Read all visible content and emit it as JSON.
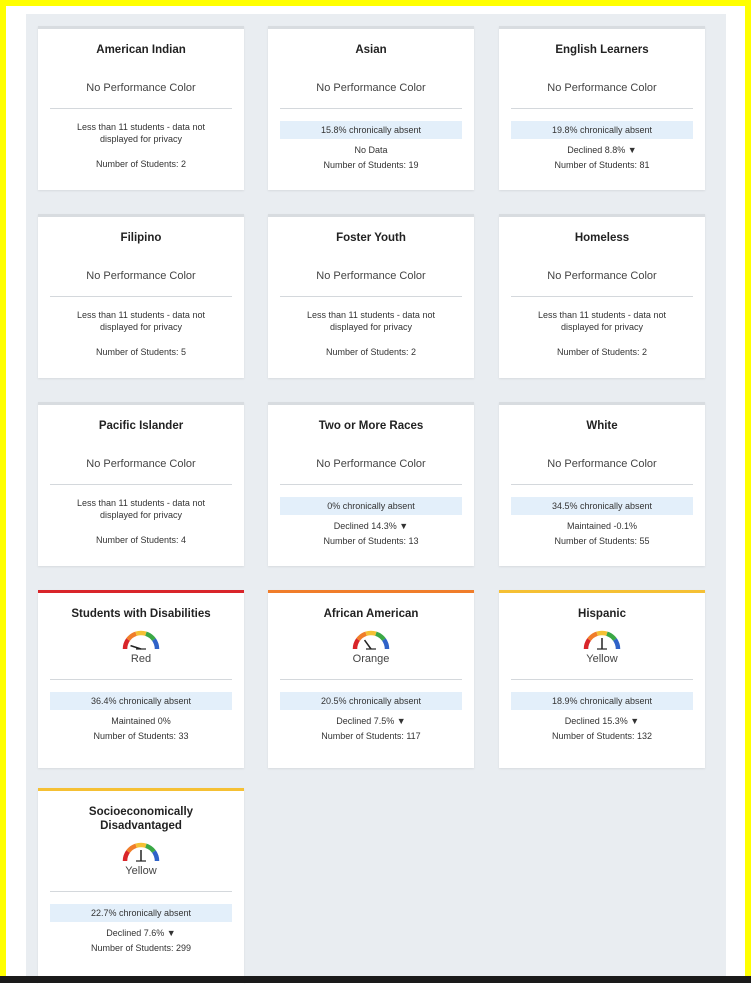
{
  "cards": [
    {
      "title": "American Indian",
      "color_label": "No Performance Color",
      "privacy": "Less than 11 students - data not displayed for privacy",
      "students": "Number of Students: 2"
    },
    {
      "title": "Asian",
      "color_label": "No Performance Color",
      "absent": "15.8% chronically absent",
      "change": "No Data",
      "students": "Number of Students: 19"
    },
    {
      "title": "English Learners",
      "color_label": "No Performance Color",
      "absent": "19.8% chronically absent",
      "change": "Declined 8.8% ▼",
      "students": "Number of Students: 81"
    },
    {
      "title": "Filipino",
      "color_label": "No Performance Color",
      "privacy": "Less than 11 students - data not displayed for privacy",
      "students": "Number of Students: 5"
    },
    {
      "title": "Foster Youth",
      "color_label": "No Performance Color",
      "privacy": "Less than 11 students - data not displayed for privacy",
      "students": "Number of Students: 2"
    },
    {
      "title": "Homeless",
      "color_label": "No Performance Color",
      "privacy": "Less than 11 students - data not displayed for privacy",
      "students": "Number of Students: 2"
    },
    {
      "title": "Pacific Islander",
      "color_label": "No Performance Color",
      "privacy": "Less than 11 students - data not displayed for privacy",
      "students": "Number of Students: 4"
    },
    {
      "title": "Two or More Races",
      "color_label": "No Performance Color",
      "absent": "0% chronically absent",
      "change": "Declined 14.3% ▼",
      "students": "Number of Students: 13"
    },
    {
      "title": "White",
      "color_label": "No Performance Color",
      "absent": "34.5% chronically absent",
      "change": "Maintained -0.1%",
      "students": "Number of Students: 55"
    },
    {
      "title": "Students with Disabilities",
      "color_label": "Red",
      "absent": "36.4% chronically absent",
      "change": "Maintained 0%",
      "students": "Number of Students: 33",
      "accent": "#d9252a",
      "gauge_level": "red"
    },
    {
      "title": "African American",
      "color_label": "Orange",
      "absent": "20.5% chronically absent",
      "change": "Declined 7.5% ▼",
      "students": "Number of Students: 117",
      "accent": "#f07d2a",
      "gauge_level": "orange"
    },
    {
      "title": "Hispanic",
      "color_label": "Yellow",
      "absent": "18.9% chronically absent",
      "change": "Declined 15.3% ▼",
      "students": "Number of Students: 132",
      "accent": "#f5c034",
      "gauge_level": "yellow"
    },
    {
      "title": "Socioeconomically Disadvantaged",
      "color_label": "Yellow",
      "absent": "22.7% chronically absent",
      "change": "Declined 7.6% ▼",
      "students": "Number of Students: 299",
      "accent": "#f5c034",
      "gauge_level": "yellow"
    }
  ],
  "gauge_colors": {
    "red": "#d9252a",
    "orange": "#f07d2a",
    "yellow": "#f5c034",
    "green": "#3aa845",
    "blue": "#2f62c8"
  }
}
